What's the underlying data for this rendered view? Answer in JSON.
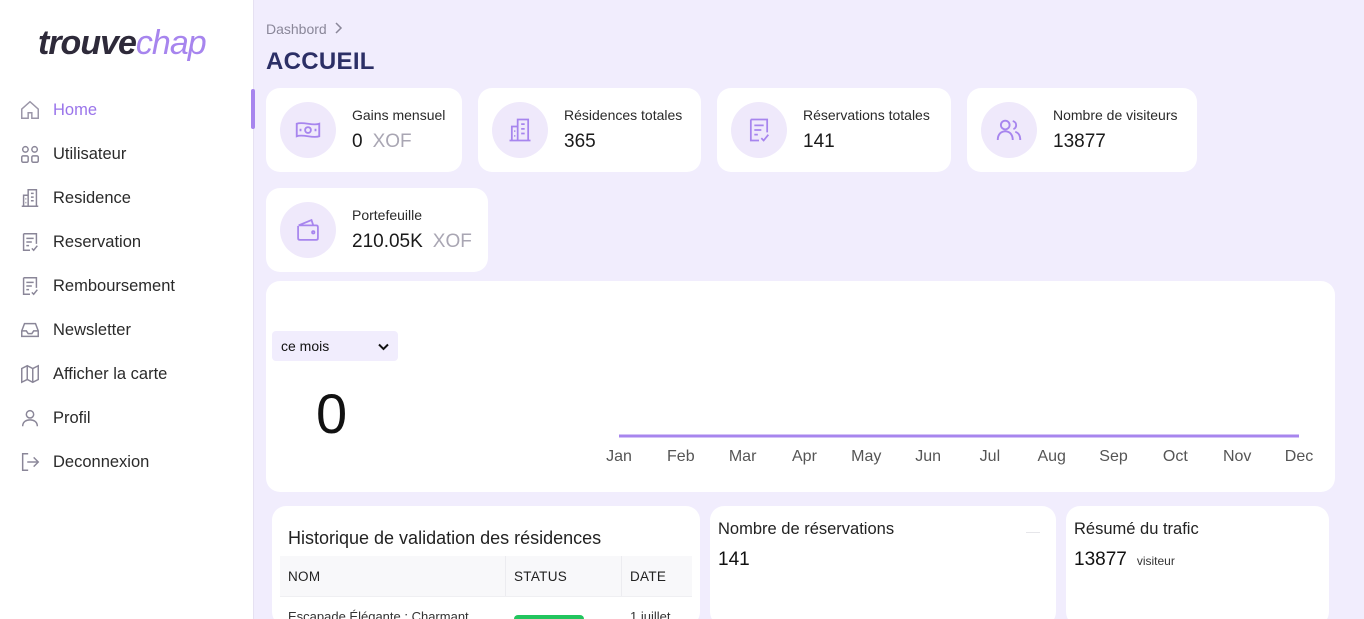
{
  "logo": {
    "part1": "trouve",
    "part2": "chap"
  },
  "nav": [
    {
      "label": "Home",
      "icon": "home-icon",
      "active": true
    },
    {
      "label": "Utilisateur",
      "icon": "users-grid-icon"
    },
    {
      "label": "Residence",
      "icon": "building-icon"
    },
    {
      "label": "Reservation",
      "icon": "receipt-icon"
    },
    {
      "label": "Remboursement",
      "icon": "receipt-check-icon"
    },
    {
      "label": "Newsletter",
      "icon": "inbox-icon"
    },
    {
      "label": "Afficher la carte",
      "icon": "map-icon"
    },
    {
      "label": "Profil",
      "icon": "user-icon"
    },
    {
      "label": "Deconnexion",
      "icon": "logout-icon"
    }
  ],
  "breadcrumb": "Dashbord",
  "page_title": "ACCUEIL",
  "stats": {
    "gains": {
      "label": "Gains mensuel",
      "value": "0",
      "currency": "XOF"
    },
    "residences": {
      "label": "Résidences totales",
      "value": "365"
    },
    "reservations": {
      "label": "Réservations totales",
      "value": "141"
    },
    "visiteurs": {
      "label": "Nombre de visiteurs",
      "value": "13877"
    },
    "portefeuille": {
      "label": "Portefeuille",
      "value": "210.05K",
      "currency": "XOF"
    }
  },
  "period_select": {
    "value": "ce mois"
  },
  "big_value": "0",
  "chart_data": {
    "type": "line",
    "categories": [
      "Jan",
      "Feb",
      "Mar",
      "Apr",
      "May",
      "Jun",
      "Jul",
      "Aug",
      "Sep",
      "Oct",
      "Nov",
      "Dec"
    ],
    "series": [
      {
        "values": [
          0,
          0,
          0,
          0,
          0,
          0,
          0,
          0,
          0,
          0,
          0,
          0
        ],
        "color": "#a785ee"
      }
    ]
  },
  "history": {
    "title": "Historique de validation des résidences",
    "columns": [
      "NOM",
      "STATUS",
      "DATE"
    ],
    "rows": [
      {
        "nom": "Escapade Élégante : Charmant",
        "date": "1 juillet"
      }
    ]
  },
  "reservations_card": {
    "label": "Nombre de réservations",
    "value": "141"
  },
  "traffic_card": {
    "label": "Résumé du trafic",
    "value": "13877",
    "unit": "visiteur"
  },
  "colors": {
    "accent": "#a785ee",
    "background": "#f1edfd",
    "title": "#2c2f66",
    "status_green": "#22c55e"
  }
}
